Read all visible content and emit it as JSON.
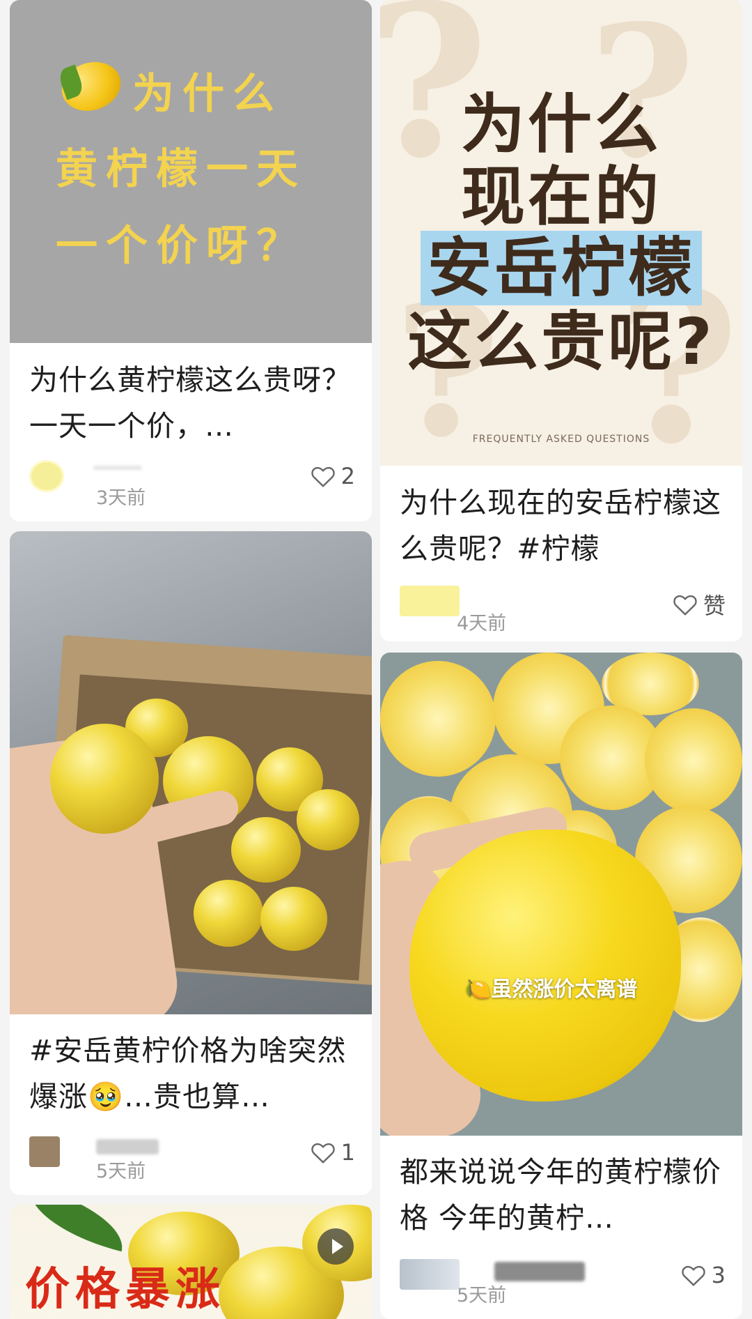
{
  "feed": {
    "cards": [
      {
        "cover_lines": [
          "为什么",
          "黄柠檬一天",
          "一个价呀？"
        ],
        "title": "为什么黄柠檬这么贵呀？一天一个价，…",
        "time": "3天前",
        "likes": "2"
      },
      {
        "cover_lines": [
          "为什么",
          "现在的",
          "安岳柠檬",
          "这么贵呢?"
        ],
        "cover_footer": "FREQUENTLY ASKED QUESTIONS",
        "title": "为什么现在的安岳柠檬这么贵呢？#柠檬",
        "time": "4天前",
        "likes": "赞"
      },
      {
        "title": "#安岳黄柠价格为啥突然爆涨🥹…贵也算…",
        "time": "5天前",
        "likes": "1"
      },
      {
        "cover_overlay": "🍋虽然涨价太离谱",
        "title": "都来说说今年的黄柠檬价格 今年的黄柠…",
        "time": "5天前",
        "likes": "3"
      },
      {
        "cover_text": "价格暴涨"
      }
    ],
    "colors": {
      "accent_yellow": "#f3d34f",
      "highlight_blue": "#a9d6ef",
      "cover_red": "#d92a17"
    },
    "icons": {
      "like": "heart-outline-icon",
      "video": "play-icon",
      "lemon": "lemon-emoji-icon"
    }
  }
}
